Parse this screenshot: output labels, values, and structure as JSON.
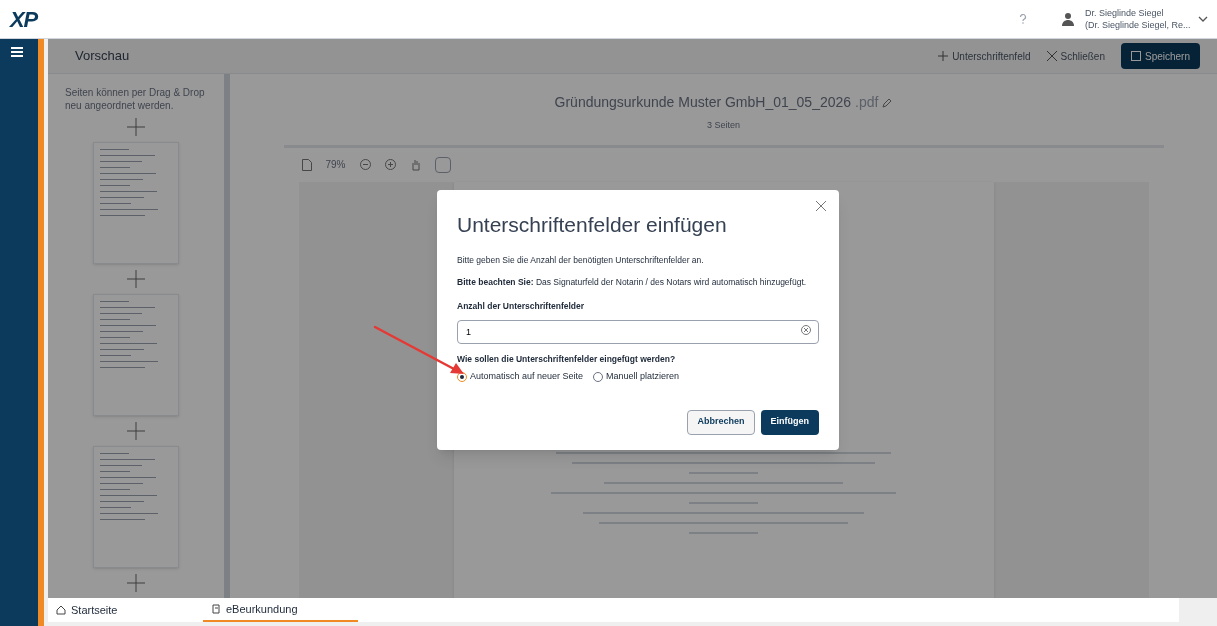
{
  "header": {
    "logo": "XP",
    "user_name": "Dr. Sieglinde Siegel",
    "user_detail": "(Dr. Sieglinde Siegel, Re..."
  },
  "toolbar": {
    "title": "Vorschau",
    "actions": [
      {
        "kind": "add",
        "label": "Unterschriftenfeld"
      },
      {
        "kind": "close",
        "label": "Schließen"
      }
    ],
    "save_label": "Speichern"
  },
  "pages_panel": {
    "hint": "Seiten können per Drag & Drop neu angeordnet werden."
  },
  "document": {
    "title": "Gründungsurkunde Muster GmbH_01_05_2026",
    "extension": ".pdf",
    "subtitle": "3 Seiten",
    "zoom": "79%"
  },
  "dialog": {
    "title": "Unterschriftenfelder einfügen",
    "text": "Bitte geben Sie die Anzahl der benötigten Unterschriftenfelder an.",
    "note": "**Bitte beachten Sie:** Das Signaturfeld der Notarin / des Notars wird automatisch hinzugefügt.",
    "field_label": "Anzahl der Unterschriftenfelder",
    "field_value": "1",
    "question": "Wie sollen die Unterschriftenfelder eingefügt werden?",
    "options": [
      {
        "label": "Automatisch auf neuer Seite",
        "selected": true
      },
      {
        "label": "Manuell platzieren",
        "selected": false
      }
    ],
    "cancel": "Abbrechen",
    "confirm": "Einfügen"
  },
  "bottom_tabs": [
    {
      "label": "Startseite",
      "kind": "home",
      "selected": false
    },
    {
      "label": "eBeurkundung",
      "kind": "document",
      "selected": true
    }
  ]
}
